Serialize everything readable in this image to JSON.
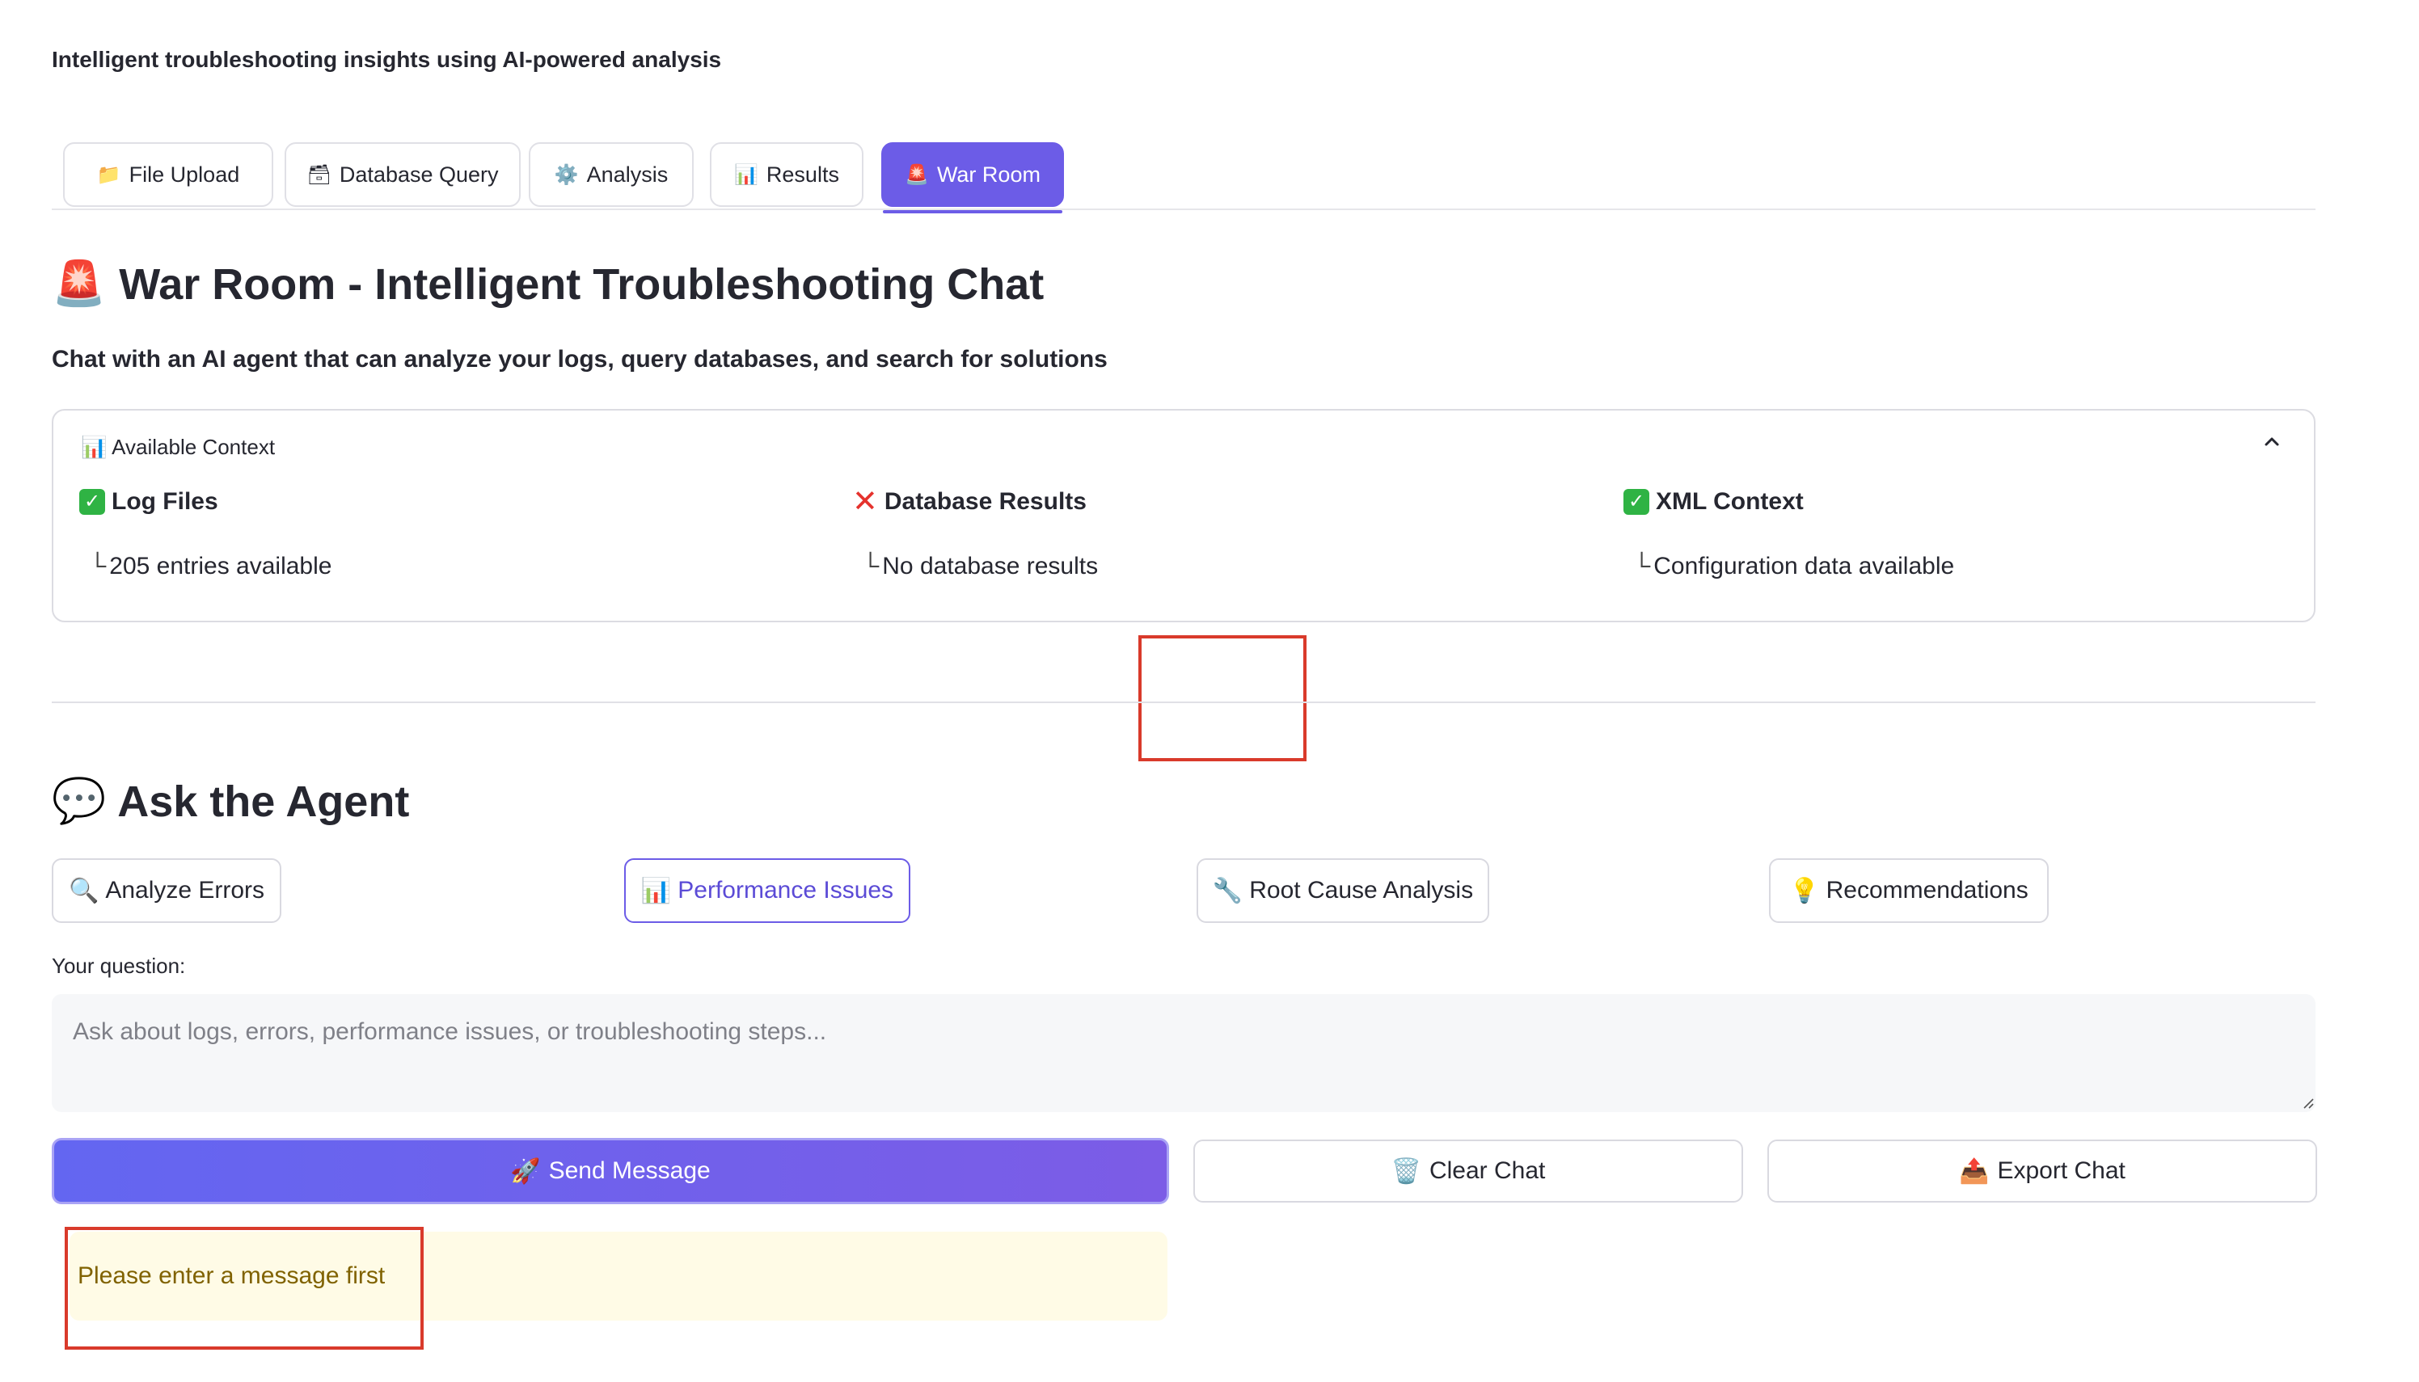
{
  "page": {
    "subtitle": "Intelligent troubleshooting insights using AI-powered analysis"
  },
  "tabs": [
    {
      "icon": "📁",
      "label": "File Upload"
    },
    {
      "icon": "🗃",
      "label": "Database Query"
    },
    {
      "icon": "⚙️",
      "label": "Analysis"
    },
    {
      "icon": "📊",
      "label": "Results"
    },
    {
      "icon": "🚨",
      "label": "War Room",
      "active": true
    }
  ],
  "war_room": {
    "icon": "🚨",
    "title": "War Room - Intelligent Troubleshooting Chat",
    "description": "Chat with an AI agent that can analyze your logs, query databases, and search for solutions"
  },
  "context": {
    "header_icon": "📊",
    "header": "Available Context",
    "items": [
      {
        "status": "ok",
        "title": "Log Files",
        "detail": "205 entries available"
      },
      {
        "status": "missing",
        "title": "Database Results",
        "detail": "No database results"
      },
      {
        "status": "ok",
        "title": "XML Context",
        "detail": "Configuration data available"
      }
    ],
    "tree_glyph": "└"
  },
  "ask": {
    "icon": "💬",
    "title": "Ask the Agent",
    "quick": [
      {
        "icon": "🔍",
        "label": "Analyze Errors"
      },
      {
        "icon": "📊",
        "label": "Performance Issues"
      },
      {
        "icon": "🔧",
        "label": "Root Cause Analysis"
      },
      {
        "icon": "💡",
        "label": "Recommendations"
      }
    ],
    "question_label": "Your question:",
    "placeholder": "Ask about logs, errors, performance issues, or troubleshooting steps...",
    "send": {
      "icon": "🚀",
      "label": "Send Message"
    },
    "clear": {
      "icon": "🗑️",
      "label": "Clear Chat"
    },
    "export": {
      "icon": "📤",
      "label": "Export Chat"
    },
    "warning": "Please enter a message first"
  },
  "colors": {
    "accent": "#6c5ce7",
    "warning_bg": "#fffbe6",
    "warning_text": "#806200",
    "ok": "#2fb344",
    "error": "#e5322d",
    "marker": "#d93a2b"
  }
}
